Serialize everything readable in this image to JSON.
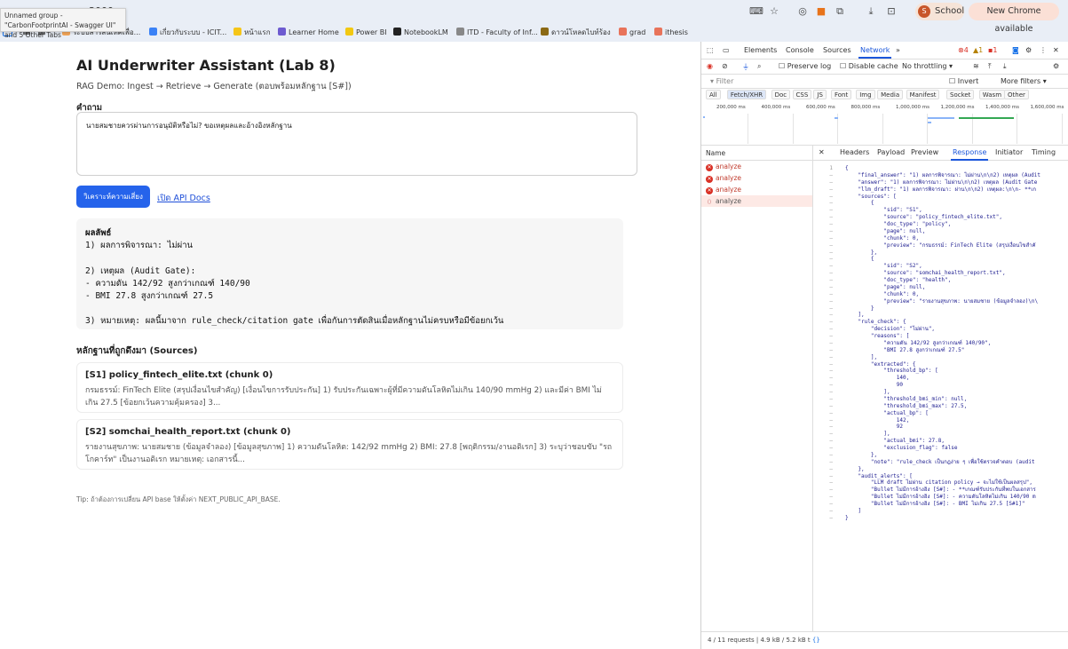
{
  "browser": {
    "tab_tooltip": "Unnamed group - \"CarbonFootprintAI - Swagger UI\" and 5 Other Tabs",
    "address": "3000",
    "profile_label": "School",
    "profile_initial": "S",
    "update_label": "New Chrome available",
    "bookmarks": [
      {
        "label": "ระบบสารสนเทศเพื่อ...",
        "color": "#f2a65a"
      },
      {
        "label": "เกี่ยวกับระบบ - ICIT...",
        "color": "#3b82f6"
      },
      {
        "label": "หน้าแรก",
        "color": "#f5c518"
      },
      {
        "label": "Learner Home",
        "color": "#6d5bd0"
      },
      {
        "label": "Power BI",
        "color": "#f2c811"
      },
      {
        "label": "NotebookLM",
        "color": "#222222"
      },
      {
        "label": "ITD - Faculty of Inf...",
        "color": "#888888"
      },
      {
        "label": "ดาวน์โหลดไบท์ร้อง",
        "color": "#8b6914"
      },
      {
        "label": "grad",
        "color": "#e8735a"
      },
      {
        "label": "ithesis",
        "color": "#e8735a"
      }
    ]
  },
  "app": {
    "title": "AI Underwriter Assistant (Lab 8)",
    "subtitle": "RAG Demo: Ingest → Retrieve → Generate (ตอบพร้อมหลักฐาน [S#])",
    "question_label": "คำถาม",
    "question_value": "นายสมชายควรผ่านการอนุมัติหรือไม่? ขอเหตุผลและอ้างอิงหลักฐาน",
    "analyze_label": "วิเคราะห์ความเสี่ยง",
    "api_docs_label": "เปิด API Docs",
    "result_heading": "ผลลัพธ์",
    "result_text": "1) ผลการพิจารณา: ไม่ผ่าน\n\n2) เหตุผล (Audit Gate):\n- ความดัน 142/92 สูงกว่าเกณฑ์ 140/90\n- BMI 27.8 สูงกว่าเกณฑ์ 27.5\n\n3) หมายเหตุ: ผลนี้มาจาก rule_check/citation gate เพื่อกันการตัดสินเมื่อหลักฐานไม่ครบหรือมีข้อยกเว้น",
    "sources_title": "หลักฐานที่ถูกดึงมา (Sources)",
    "sources": [
      {
        "title": "[S1] policy_fintech_elite.txt (chunk 0)",
        "preview": "กรมธรรม์: FinTech Elite (สรุปเงื่อนไขสำคัญ) [เงื่อนไขการรับประกัน] 1) รับประกันเฉพาะผู้ที่มีความดันโลหิตไม่เกิน 140/90 mmHg 2) และมีค่า BMI ไม่เกิน 27.5 [ข้อยกเว้นความคุ้มครอง] 3..."
      },
      {
        "title": "[S2] somchai_health_report.txt (chunk 0)",
        "preview": "รายงานสุขภาพ: นายสมชาย (ข้อมูลจำลอง) [ข้อมูลสุขภาพ] 1) ความดันโลหิต: 142/92 mmHg 2) BMI: 27.8 [พฤติกรรม/งานอดิเรก] 3) ระบุว่าชอบขับ \"รถโกคาร์ท\" เป็นงานอดิเรก หมายเหตุ: เอกสารนี้..."
      }
    ],
    "tip": "Tip: ถ้าต้องการเปลี่ยน API base ให้ตั้งค่า NEXT_PUBLIC_API_BASE."
  },
  "devtools": {
    "tabs": [
      "Elements",
      "Console",
      "Sources",
      "Network"
    ],
    "active_tab": "Network",
    "more": "»",
    "error_count": "4",
    "warn_count": "1",
    "issue_count": "1",
    "preserve_log": "Preserve log",
    "disable_cache": "Disable cache",
    "throttle": "No throttling",
    "filter_placeholder": "Filter",
    "invert": "Invert",
    "more_filters": "More filters",
    "types": [
      "All",
      "Fetch/XHR",
      "Doc",
      "CSS",
      "JS",
      "Font",
      "Img",
      "Media",
      "Manifest",
      "Socket",
      "Wasm",
      "Other"
    ],
    "active_type": "Fetch/XHR",
    "ticks": [
      "200,000 ms",
      "400,000 ms",
      "600,000 ms",
      "800,000 ms",
      "1,000,000 ms",
      "1,200,000 ms",
      "1,400,000 ms",
      "1,600,000 ms"
    ],
    "name_header": "Name",
    "requests": [
      {
        "name": "analyze",
        "status": "error"
      },
      {
        "name": "analyze",
        "status": "error"
      },
      {
        "name": "analyze",
        "status": "error"
      },
      {
        "name": "analyze",
        "status": "selected"
      }
    ],
    "detail_tabs": [
      "Headers",
      "Payload",
      "Preview",
      "Response",
      "Initiator",
      "Timing"
    ],
    "active_detail_tab": "Response",
    "response_lines": [
      "{",
      "    \"final_answer\": \"1) ผลการพิจารณา: ไม่ผ่าน\\n\\n2) เหตุผล (Audit",
      "    \"answer\": \"1) ผลการพิจารณา: ไม่ผ่าน\\n\\n2) เหตุผล (Audit Gate",
      "    \"llm_draft\": \"1) ผลการพิจารณา: ผ่าน\\n\\n2) เหตุผล:\\n\\n- **เก",
      "    \"sources\": [",
      "        {",
      "            \"sid\": \"S1\",",
      "            \"source\": \"policy_fintech_elite.txt\",",
      "            \"doc_type\": \"policy\",",
      "            \"page\": null,",
      "            \"chunk\": 0,",
      "            \"preview\": \"กรมธรรม์: FinTech Elite (สรุปเงื่อนไขสำคั",
      "        },",
      "        {",
      "            \"sid\": \"S2\",",
      "            \"source\": \"somchai_health_report.txt\",",
      "            \"doc_type\": \"health\",",
      "            \"page\": null,",
      "            \"chunk\": 0,",
      "            \"preview\": \"รายงานสุขภาพ: นายสมชาย (ข้อมูลจำลอง)\\n\\",
      "        }",
      "    ],",
      "    \"rule_check\": {",
      "        \"decision\": \"ไม่ผ่าน\",",
      "        \"reasons\": [",
      "            \"ความดัน 142/92 สูงกว่าเกณฑ์ 140/90\",",
      "            \"BMI 27.8 สูงกว่าเกณฑ์ 27.5\"",
      "        ],",
      "        \"extracted\": {",
      "            \"threshold_bp\": [",
      "                140,",
      "                90",
      "            ],",
      "            \"threshold_bmi_min\": null,",
      "            \"threshold_bmi_max\": 27.5,",
      "            \"actual_bp\": [",
      "                142,",
      "                92",
      "            ],",
      "            \"actual_bmi\": 27.8,",
      "            \"exclusion_flag\": false",
      "        },",
      "        \"note\": \"rule_check เป็นกฎง่าย ๆ เพื่อใช้ตรวจคำตอบ (audit",
      "    },",
      "    \"audit_alerts\": [",
      "        \"LLM draft ไม่ผ่าน citation policy → จะไม่ใช้เป็นผลสรุป\",",
      "        \"Bullet ไม่มีการอ้างอิง [S#]: - **เกณฑ์รับประกันที่พบในเอกสาร",
      "        \"Bullet ไม่มีการอ้างอิง [S#]: - ความดันโลหิตไม่เกิน 140/90 m",
      "        \"Bullet ไม่มีการอ้างอิง [S#]: - BMI ไม่เกิน 27.5 [S#1]\"",
      "    ]",
      "}"
    ],
    "status": "4 / 11 requests  |  4.9 kB / 5.2 kB t"
  }
}
